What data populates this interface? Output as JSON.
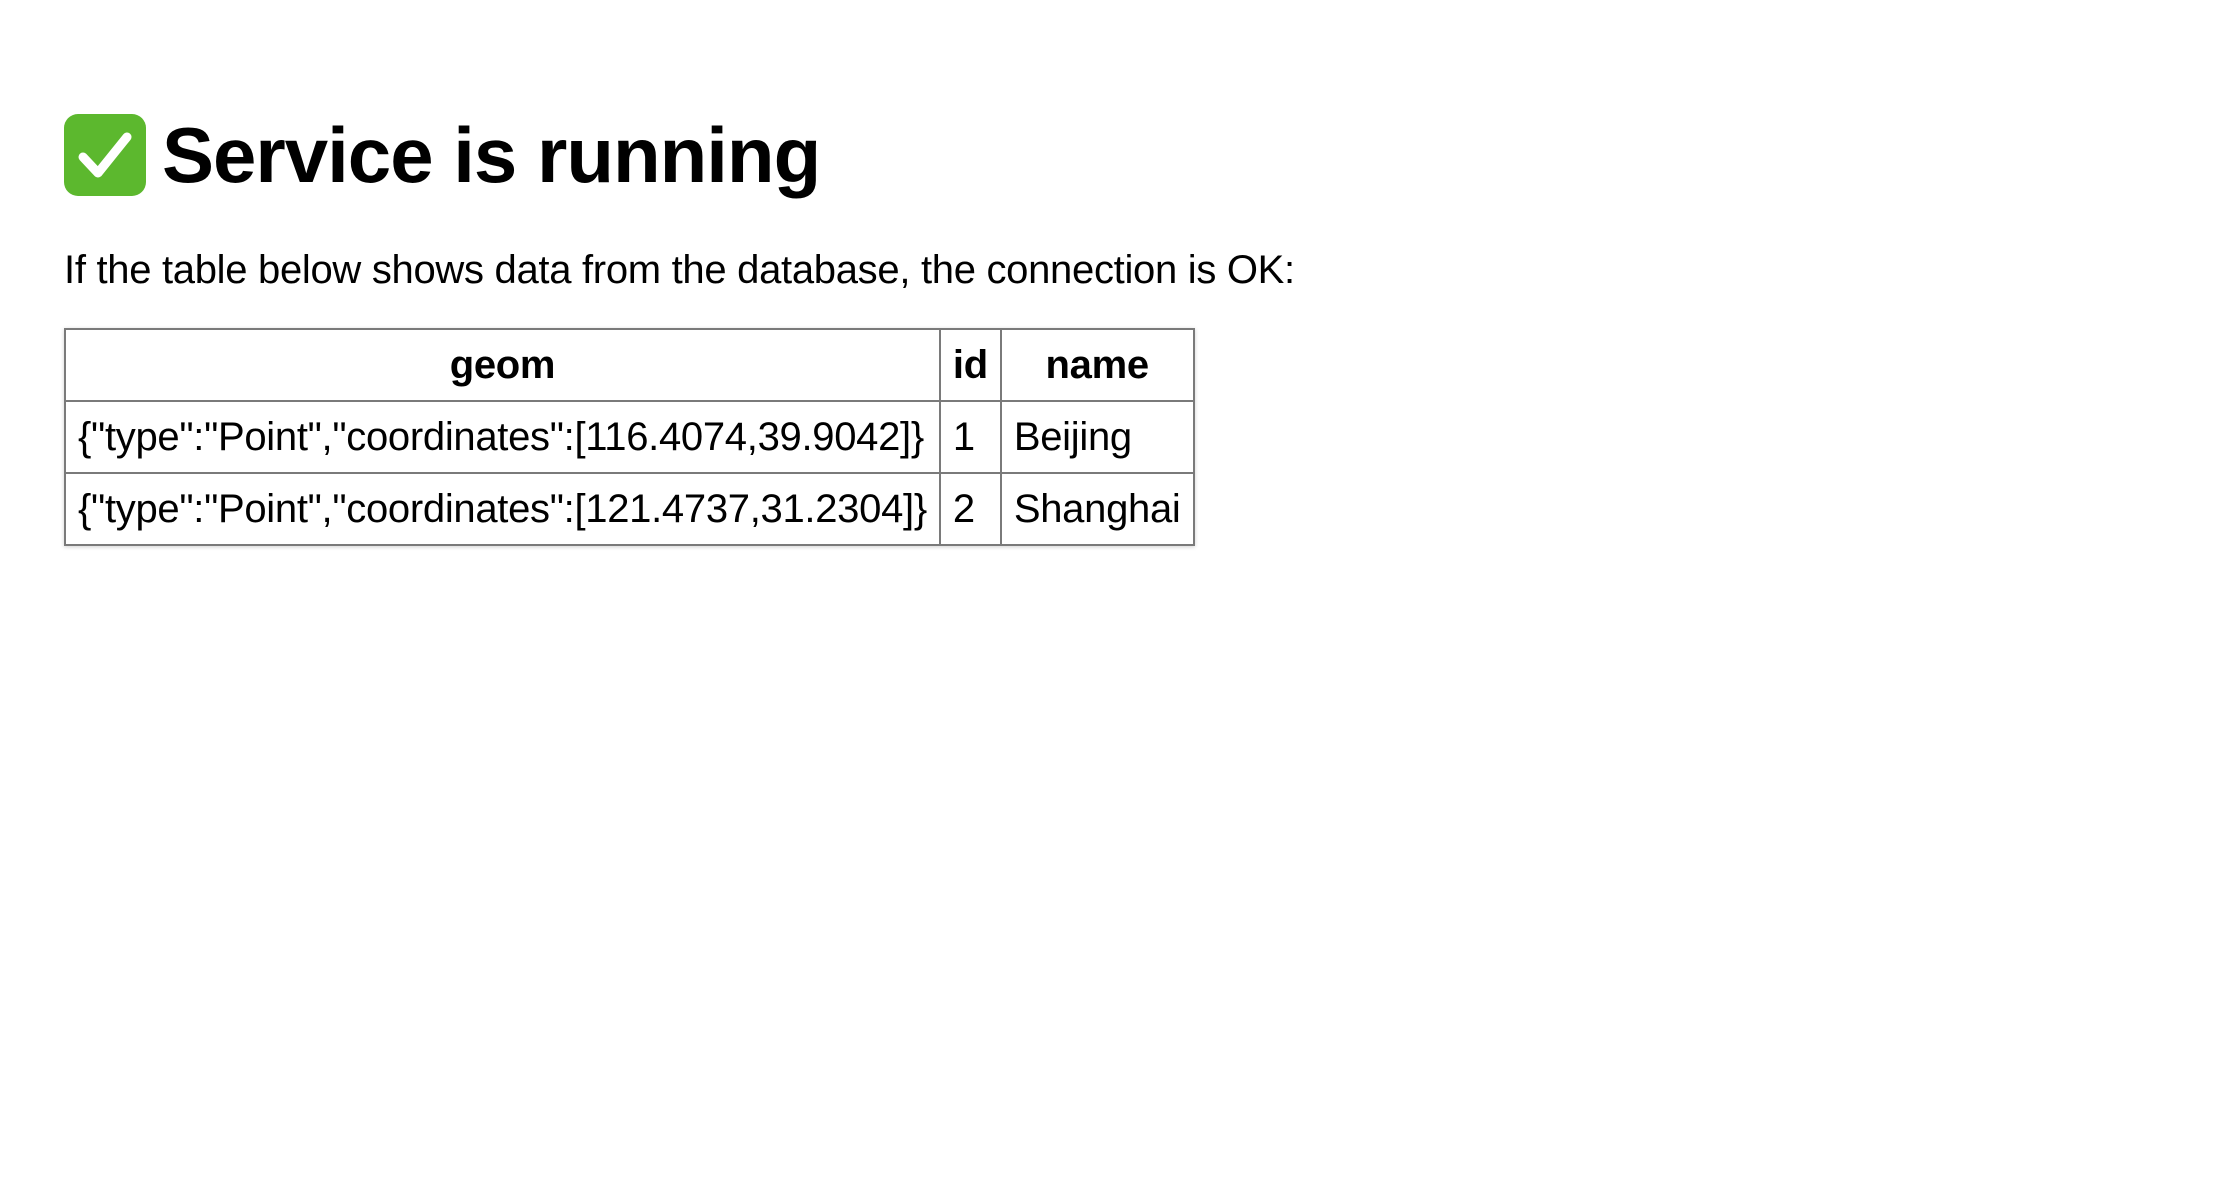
{
  "header": {
    "status_icon": "check-mark-icon",
    "title": "Service is running"
  },
  "intro": {
    "text": "If the table below shows data from the database, the connection is OK:"
  },
  "table": {
    "columns": [
      "geom",
      "id",
      "name"
    ],
    "rows": [
      [
        "{\"type\":\"Point\",\"coordinates\":[116.4074,39.9042]}",
        "1",
        "Beijing"
      ],
      [
        "{\"type\":\"Point\",\"coordinates\":[121.4737,31.2304]}",
        "2",
        "Shanghai"
      ]
    ]
  },
  "colors": {
    "check_badge": "#5cb82e",
    "check_mark": "#ffffff",
    "table_border": "#7a7a7a"
  }
}
